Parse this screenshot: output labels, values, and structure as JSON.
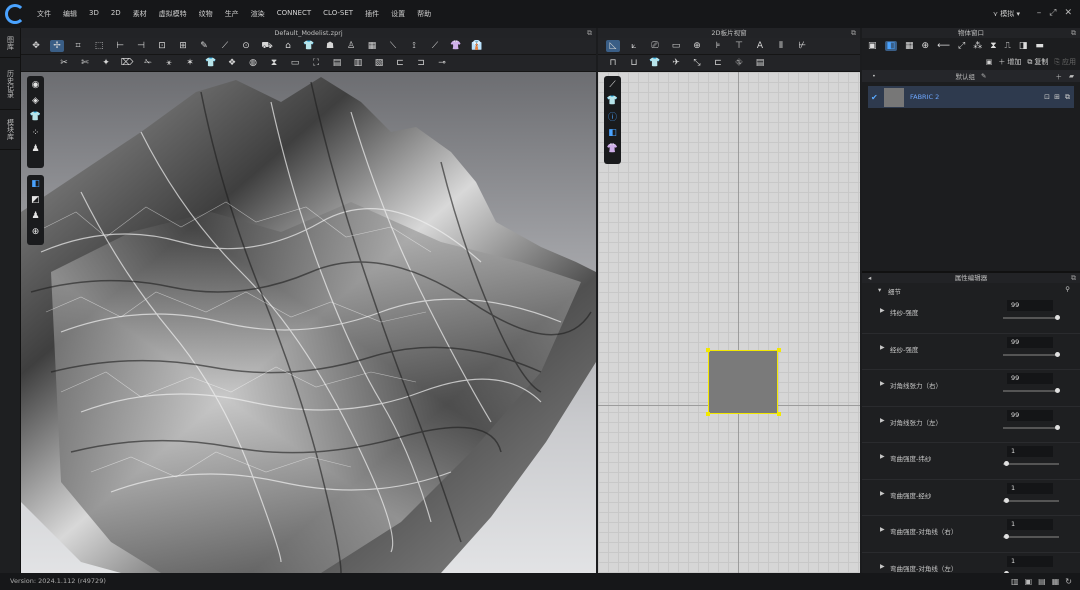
{
  "menubar": {
    "items": [
      "文件",
      "编辑",
      "3D",
      "2D",
      "素材",
      "虚拟模特",
      "纹物",
      "生产",
      "渲染",
      "CONNECT",
      "CLO-SET",
      "插件",
      "设置",
      "帮助"
    ],
    "user": "模拟"
  },
  "sidebar_tabs": [
    "图库",
    "历史记录",
    "模块库"
  ],
  "view3d": {
    "title": "Default_Modelist.zprj"
  },
  "view2d": {
    "title": "2D板片视窗"
  },
  "object_window": {
    "title": "物体窗口",
    "add_label": "增加",
    "copy_label": "复制",
    "apply_label": "应用",
    "group_label": "默认组",
    "fabric_name": "FABRIC 2"
  },
  "property_editor": {
    "title": "属性编辑器",
    "section": "细节",
    "rows": [
      {
        "label": "纬纱-强度",
        "value": "99",
        "fraction": 0.98
      },
      {
        "label": "经纱-强度",
        "value": "99",
        "fraction": 0.98
      },
      {
        "label": "对角线张力（右）",
        "value": "99",
        "fraction": 0.98
      },
      {
        "label": "对角线张力（左）",
        "value": "99",
        "fraction": 0.98
      },
      {
        "label": "弯曲强度-纬纱",
        "value": "1",
        "fraction": 0.01
      },
      {
        "label": "弯曲强度-经纱",
        "value": "1",
        "fraction": 0.01
      },
      {
        "label": "弯曲强度-对角线（右）",
        "value": "1",
        "fraction": 0.01
      },
      {
        "label": "弯曲强度-对角线（左）",
        "value": "1",
        "fraction": 0.01
      }
    ]
  },
  "status": {
    "version": "Version: 2024.1.112 (r49729)"
  }
}
